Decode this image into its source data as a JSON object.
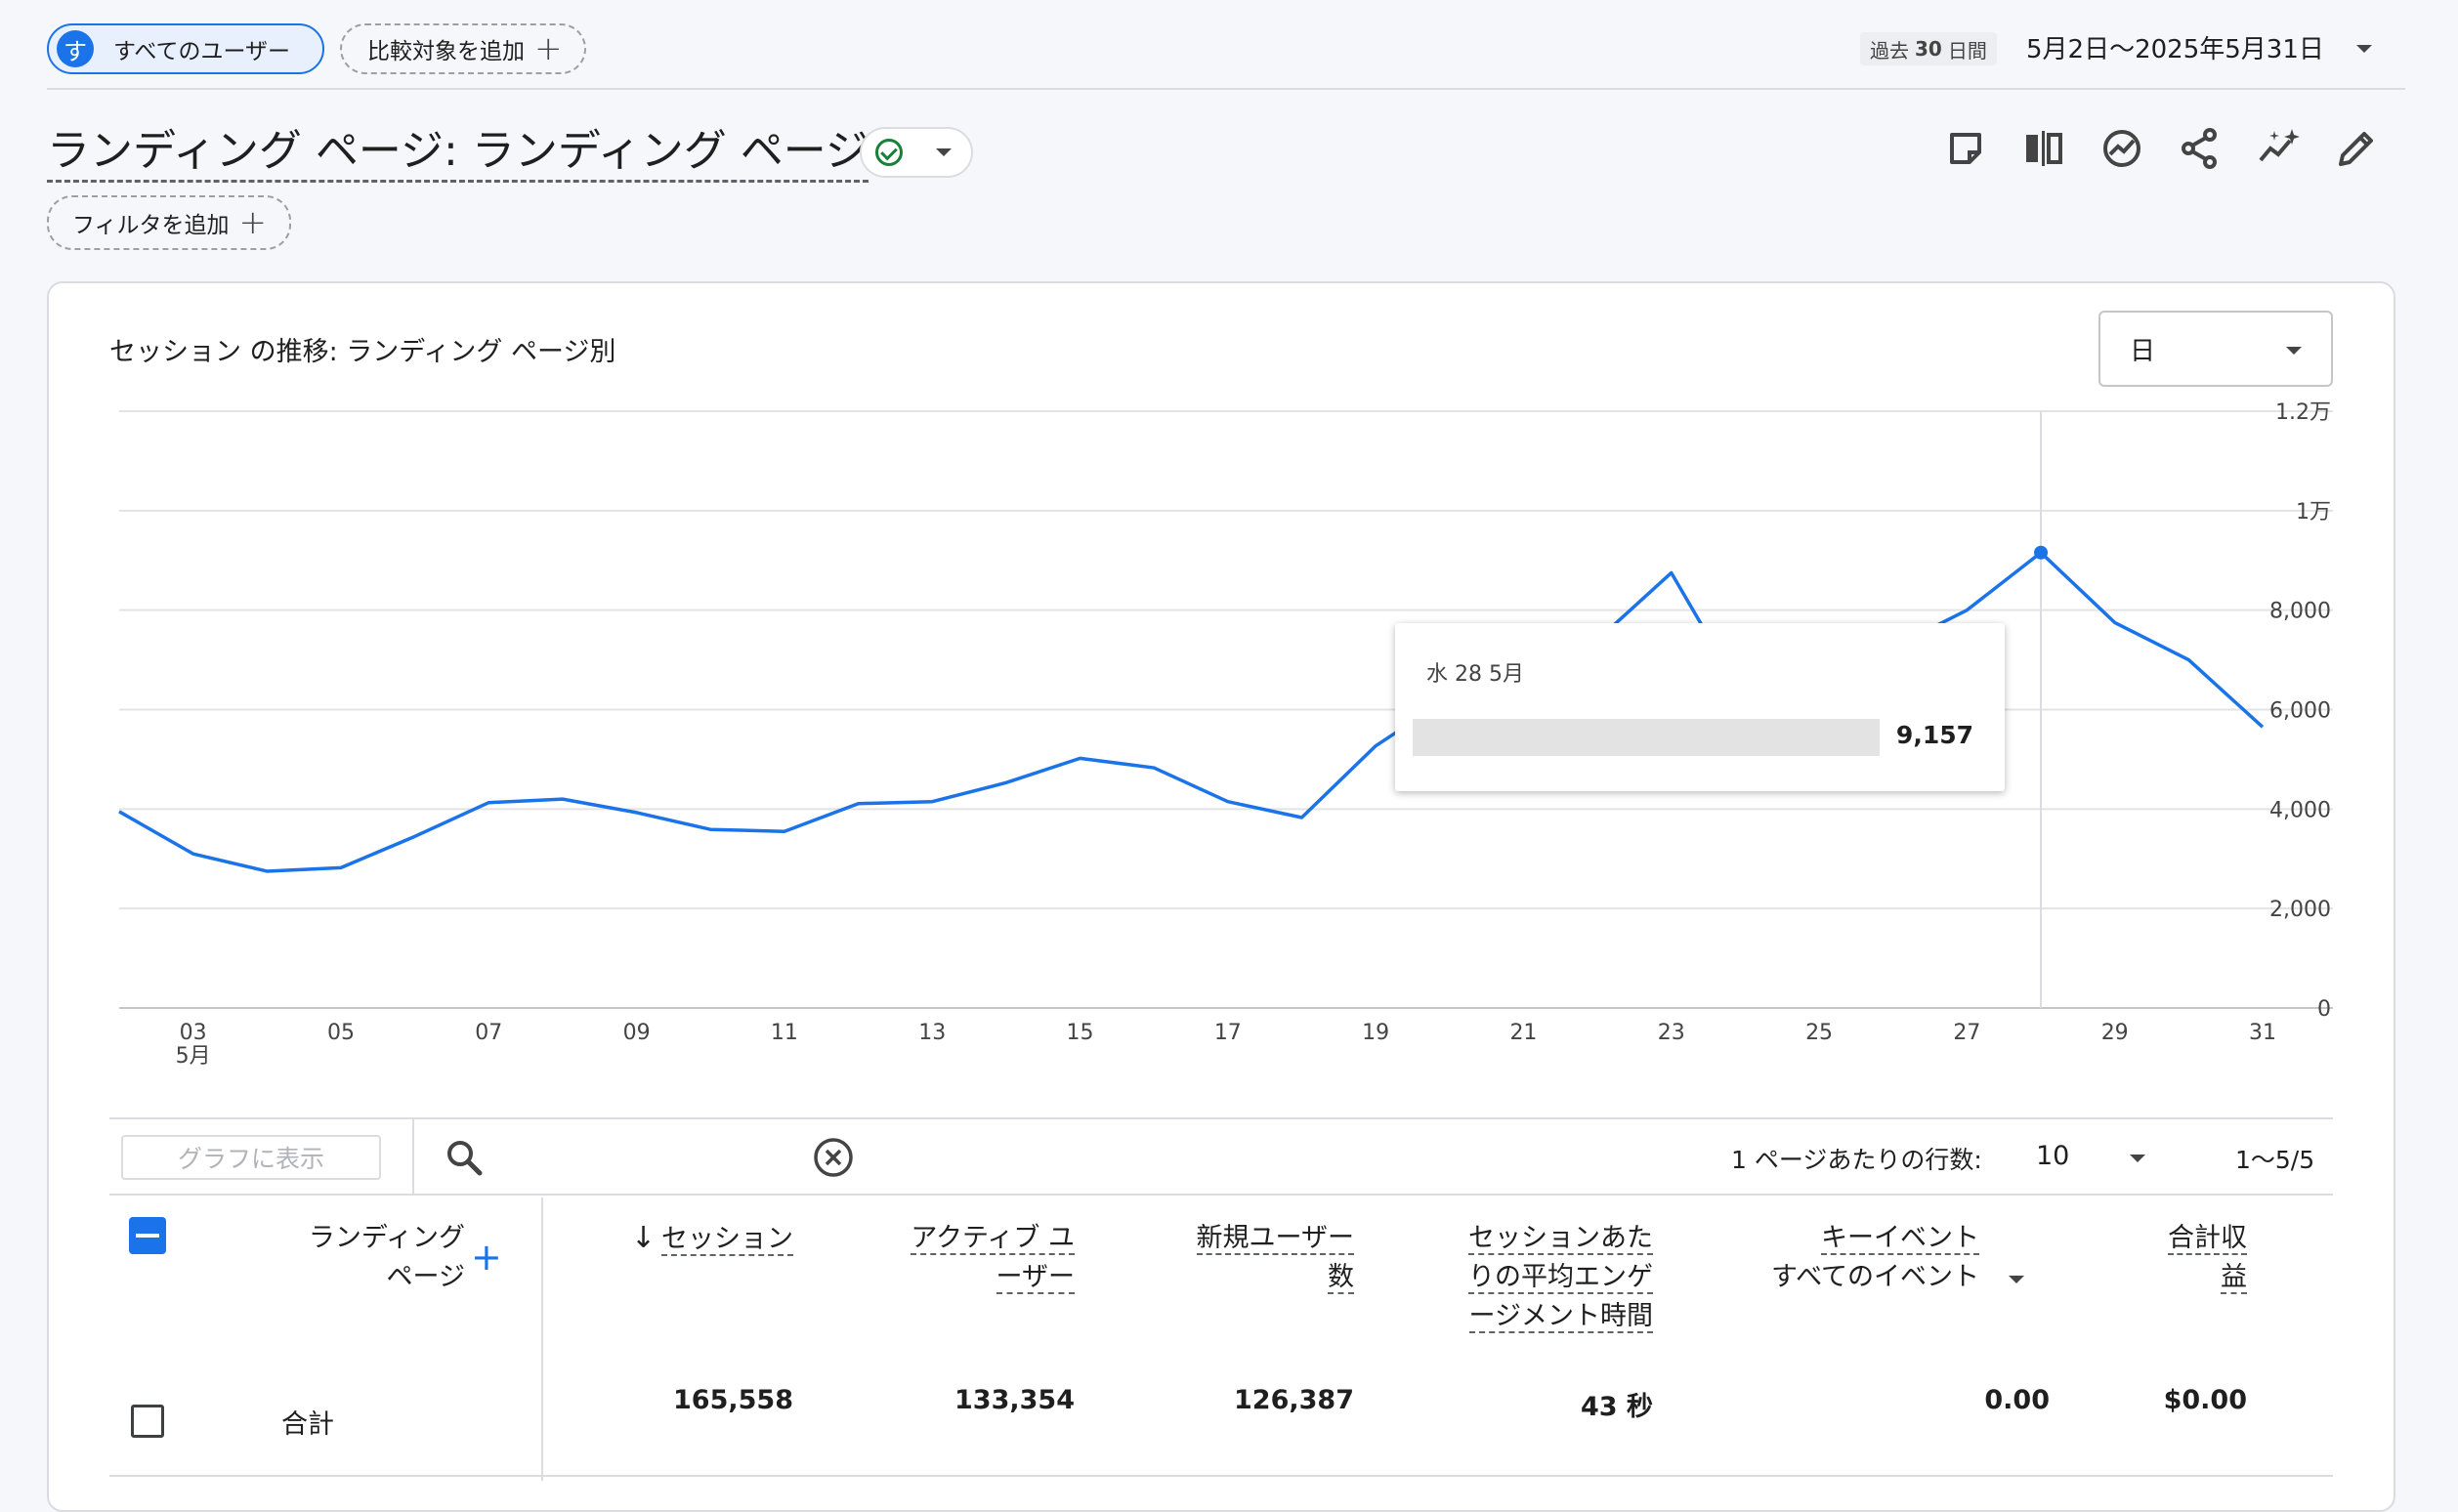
{
  "segment": {
    "avatar_letter": "す",
    "label": "すべてのユーザー"
  },
  "compare": {
    "label": "比較対象を追加"
  },
  "period": {
    "prefix": "過去",
    "days": "30",
    "suffix": "日間",
    "range": "5月2日〜2025年5月31日"
  },
  "page": {
    "title": "ランディング ページ: ランディング ページ",
    "add_filter": "フィルタを追加"
  },
  "toolbar_icons": [
    "note-icon",
    "compare-columns-icon",
    "insights-icon",
    "share-icon",
    "spark-icon",
    "edit-icon"
  ],
  "chart": {
    "title": "セッション の推移: ランディング ページ別",
    "granularity": "日"
  },
  "tooltip": {
    "date": "水 28 5月",
    "value": "9,157"
  },
  "chart_data": {
    "type": "line",
    "title": "セッション の推移: ランディング ページ別",
    "x": [
      "02",
      "03",
      "04",
      "05",
      "06",
      "07",
      "08",
      "09",
      "10",
      "11",
      "12",
      "13",
      "14",
      "15",
      "16",
      "17",
      "18",
      "19",
      "20",
      "21",
      "22",
      "23",
      "24",
      "25",
      "26",
      "27",
      "28",
      "29",
      "30",
      "31"
    ],
    "x_tick_labels": [
      "03",
      "05",
      "07",
      "09",
      "11",
      "13",
      "15",
      "17",
      "19",
      "21",
      "23",
      "25",
      "27",
      "29",
      "31"
    ],
    "x_month_label": "5月",
    "y_tick_labels": [
      "0",
      "2,000",
      "4,000",
      "6,000",
      "8,000",
      "1万",
      "1.2万"
    ],
    "ylim": [
      0,
      12000
    ],
    "series": [
      {
        "values": [
          3950,
          3100,
          2750,
          2820,
          3450,
          4130,
          4200,
          3930,
          3590,
          3550,
          4110,
          4150,
          4530,
          5020,
          4830,
          4150,
          3830,
          5270,
          6250,
          6400,
          7400,
          8750,
          6200,
          5900,
          7250,
          8000,
          9157,
          7750,
          7000,
          5650
        ]
      }
    ],
    "highlight_index": 26,
    "color": "#1a73e8",
    "grid": true,
    "y_axis_position": "right"
  },
  "table": {
    "graph_button": "グラフに表示",
    "rows_per_page_label": "1 ページあたりの行数:",
    "rows_per_page": "10",
    "pagination": "1〜5/5",
    "headers": {
      "dimension_line1": "ランディング",
      "dimension_line2": "ページ",
      "sessions": "セッション",
      "active_users_1": "アクティブ ユ",
      "active_users_2": "ーザー",
      "new_users_1": "新規ユーザー",
      "new_users_2": "数",
      "engagement_1": "セッションあた",
      "engagement_2": "りの平均エンゲ",
      "engagement_3": "ージメント時間",
      "key_events": "キーイベント",
      "key_events_filter": "すべてのイベント",
      "revenue_1": "合計収",
      "revenue_2": "益"
    },
    "total_row": {
      "label": "合計",
      "sessions": "165,558",
      "active_users": "133,354",
      "new_users": "126,387",
      "engagement": "43 秒",
      "key_events": "0.00",
      "revenue": "$0.00"
    }
  }
}
